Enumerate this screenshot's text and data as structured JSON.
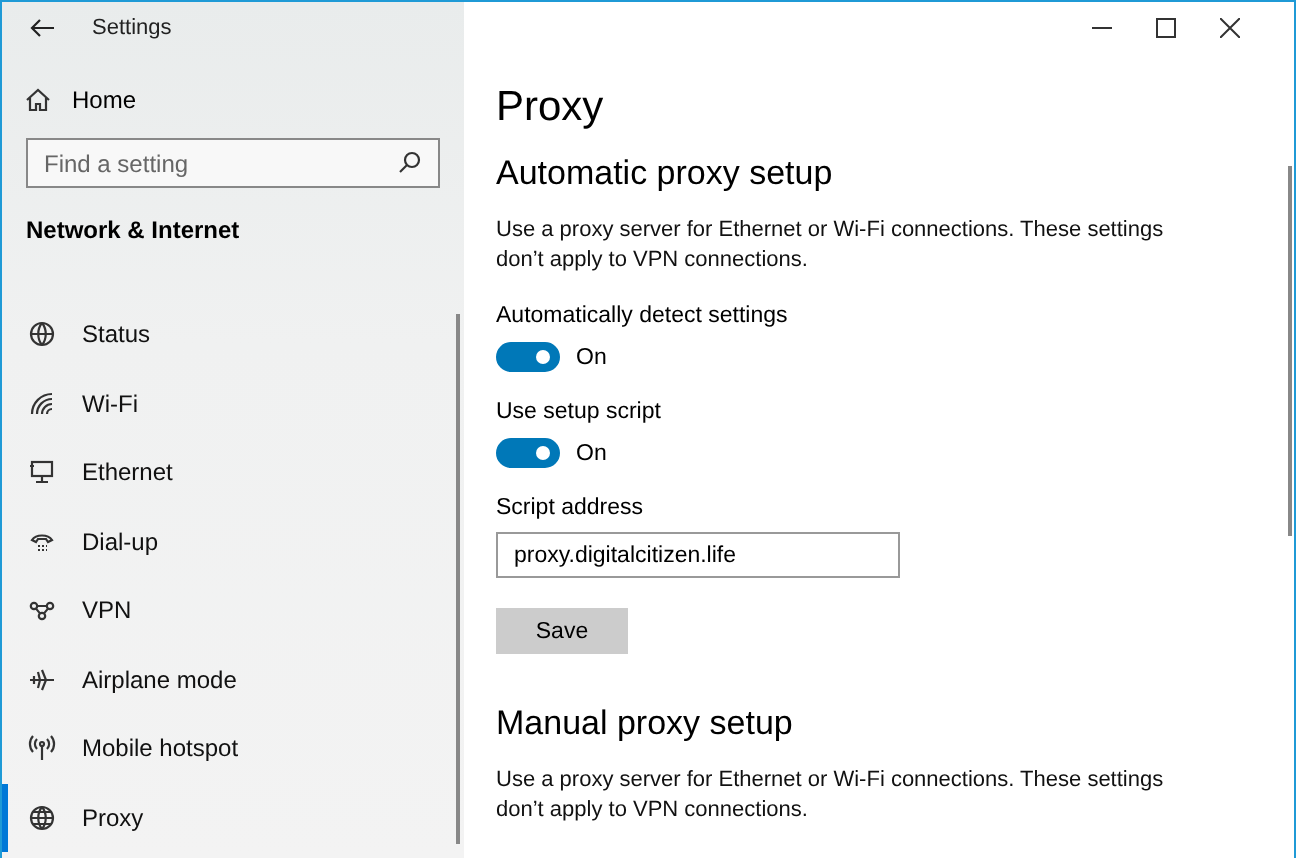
{
  "window": {
    "title": "Settings"
  },
  "sidebar": {
    "home": "Home",
    "search": {
      "placeholder": "Find a setting"
    },
    "section": "Network & Internet",
    "items": [
      {
        "label": "Status",
        "selected": false
      },
      {
        "label": "Wi-Fi",
        "selected": false
      },
      {
        "label": "Ethernet",
        "selected": false
      },
      {
        "label": "Dial-up",
        "selected": false
      },
      {
        "label": "VPN",
        "selected": false
      },
      {
        "label": "Airplane mode",
        "selected": false
      },
      {
        "label": "Mobile hotspot",
        "selected": false
      },
      {
        "label": "Proxy",
        "selected": true
      }
    ]
  },
  "page": {
    "title": "Proxy",
    "automatic": {
      "heading": "Automatic proxy setup",
      "description": "Use a proxy server for Ethernet or Wi-Fi connections. These settings don’t apply to VPN connections.",
      "toggles": [
        {
          "label": "Automatically detect settings",
          "on": true,
          "state_text": "On"
        },
        {
          "label": "Use setup script",
          "on": true,
          "state_text": "On"
        }
      ],
      "script_address": {
        "label": "Script address",
        "value": "proxy.digitalcitizen.life"
      },
      "save_button": "Save"
    },
    "manual": {
      "heading": "Manual proxy setup",
      "description": "Use a proxy server for Ethernet or Wi-Fi connections. These settings don’t apply to VPN connections."
    }
  }
}
